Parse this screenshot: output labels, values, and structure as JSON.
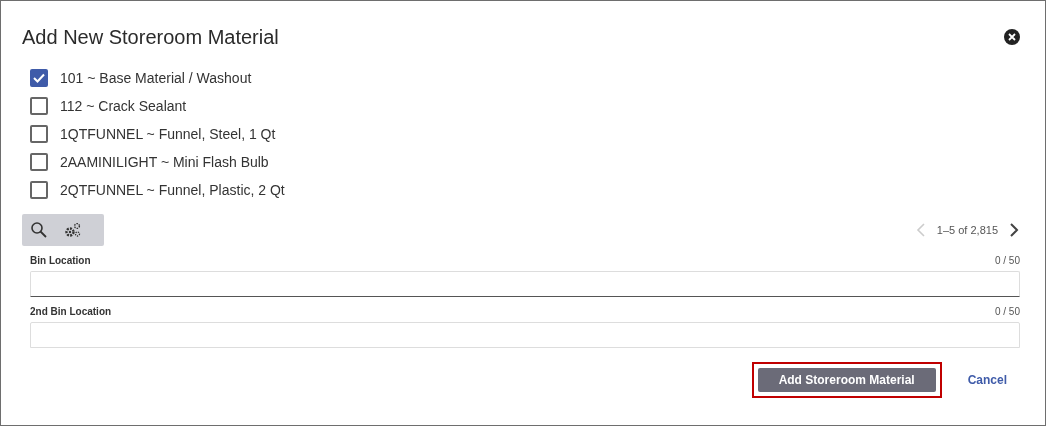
{
  "dialog": {
    "title": "Add New Storeroom Material"
  },
  "materials": [
    {
      "label": "101 ~ Base Material / Washout",
      "checked": true
    },
    {
      "label": "112 ~ Crack Sealant",
      "checked": false
    },
    {
      "label": "1QTFUNNEL ~ Funnel, Steel, 1 Qt",
      "checked": false
    },
    {
      "label": "2AAMINILIGHT ~ Mini Flash Bulb",
      "checked": false
    },
    {
      "label": "2QTFUNNEL ~ Funnel, Plastic, 2 Qt",
      "checked": false
    }
  ],
  "pagination": {
    "range": "1–5 of 2,815",
    "previous_disabled": true,
    "next_disabled": false
  },
  "fields": [
    {
      "label": "Bin Location",
      "counter": "0 / 50",
      "focused": true
    },
    {
      "label": "2nd Bin Location",
      "counter": "0 / 50",
      "focused": false
    }
  ],
  "buttons": {
    "primary": "Add Storeroom Material",
    "cancel": "Cancel",
    "primary_highlighted": true
  }
}
